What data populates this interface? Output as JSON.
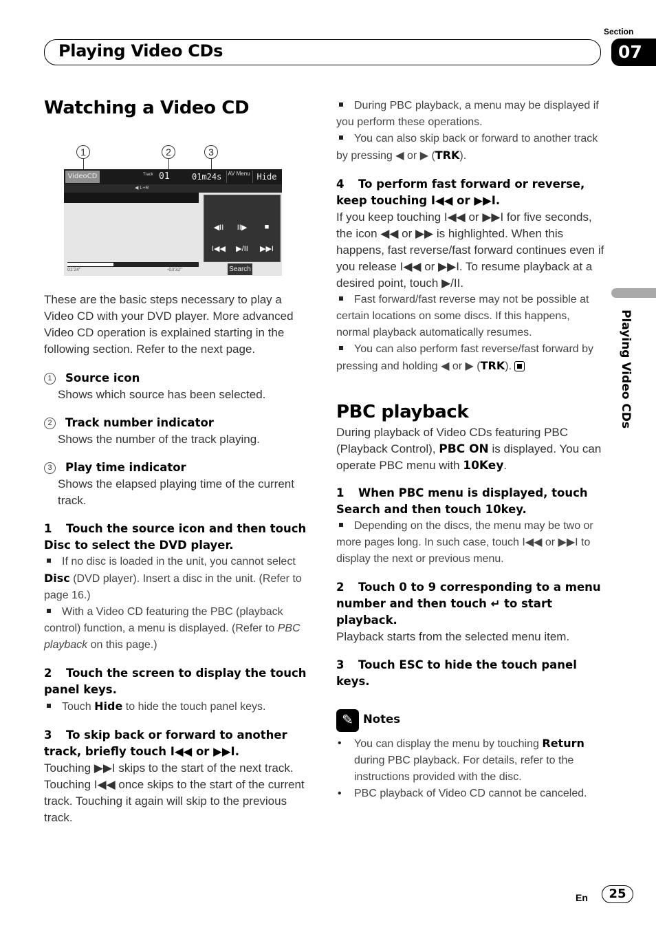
{
  "header": {
    "title": "Playing Video CDs",
    "section_label": "Section",
    "section_number": "07",
    "side_tab_text": "Playing Video CDs"
  },
  "left": {
    "heading": "Watching a Video CD",
    "screen": {
      "source_label": "VideoCD",
      "track_label": "Track",
      "track_value": "01",
      "time_value": "01m24s",
      "av_menu_label": "AV Menu",
      "hide_label": "Hide",
      "audio_label": "L+R",
      "search_label": "Search",
      "progress_fraction": 0.35,
      "elapsed_readout": "01'24\"",
      "remaining_readout": "-03'32\"",
      "buttons_row1": [
        "◀II",
        "II▶",
        "■"
      ],
      "buttons_row2": [
        "I◀◀",
        "▶/II",
        "▶▶I"
      ],
      "callouts": [
        "1",
        "2",
        "3"
      ]
    },
    "intro": "These are the basic steps necessary to play a Video CD with your DVD player. More advanced Video CD operation is explained starting in the following section. Refer to the next page.",
    "items": [
      {
        "num": "1",
        "title": "Source icon",
        "desc": "Shows which source has been selected."
      },
      {
        "num": "2",
        "title": "Track number indicator",
        "desc": "Shows the number of the track playing."
      },
      {
        "num": "3",
        "title": "Play time indicator",
        "desc": "Shows the elapsed playing time of the current track."
      }
    ],
    "step1": {
      "num": "1",
      "title": "Touch the source icon and then touch Disc to select the DVD player.",
      "note1_pre": "If no disc is loaded in the unit, you cannot select ",
      "note1_bold": "Disc",
      "note1_post": " (DVD player). Insert a disc in the unit. (Refer to page 16.)",
      "note2_pre": "With a Video CD featuring the PBC (playback control) function, a menu is displayed. (Refer to ",
      "note2_italic": "PBC playback",
      "note2_post": " on this page.)"
    },
    "step2": {
      "num": "2",
      "title": "Touch the screen to display the touch panel keys.",
      "note_pre": "Touch ",
      "note_bold": "Hide",
      "note_post": " to hide the touch panel keys."
    },
    "step3": {
      "num": "3",
      "title": "To skip back or forward to another track, briefly touch I◀◀ or ▶▶I.",
      "body": "Touching ▶▶I skips to the start of the next track. Touching I◀◀ once skips to the start of the current track. Touching it again will skip to the previous track."
    }
  },
  "right": {
    "note_a": "During PBC playback, a menu may be displayed if you perform these operations.",
    "note_b_pre": "You can also skip back or forward to another track by pressing ◀ or ▶ (",
    "note_b_bold": "TRK",
    "note_b_post": ").",
    "step4": {
      "num": "4",
      "title": "To perform fast forward or reverse, keep touching I◀◀ or ▶▶I.",
      "body": "If you keep touching I◀◀ or ▶▶I for five seconds, the icon ◀◀ or ▶▶ is highlighted. When this happens, fast reverse/fast forward continues even if you release I◀◀ or ▶▶I. To resume playback at a desired point, touch ▶/II.",
      "note1": "Fast forward/fast reverse may not be possible at certain locations on some discs. If this happens, normal playback automatically resumes.",
      "note2_pre": "You can also perform fast reverse/fast forward by pressing and holding ◀ or ▶ (",
      "note2_bold": "TRK",
      "note2_post": ")."
    },
    "pbc": {
      "heading": "PBC playback",
      "intro_pre": "During playback of Video CDs featuring PBC (Playback Control), ",
      "intro_bold1": "PBC ON",
      "intro_mid": " is displayed. You can operate PBC menu with ",
      "intro_bold2": "10Key",
      "intro_post": ".",
      "step1_num": "1",
      "step1_title": "When PBC menu is displayed, touch Search and then touch 10key.",
      "step1_note": "Depending on the discs, the menu may be two or more pages long. In such case, touch I◀◀ or ▶▶I to display the next or previous menu.",
      "step2_num": "2",
      "step2_title": "Touch 0 to 9 corresponding to a menu number and then touch ↵ to start playback.",
      "step2_body": "Playback starts from the selected menu item.",
      "step3_num": "3",
      "step3_title": "Touch ESC to hide the touch panel keys."
    },
    "notes": {
      "title": "Notes",
      "item1_pre": "You can display the menu by touching ",
      "item1_bold": "Return",
      "item1_post": " during PBC playback. For details, refer to the instructions provided with the disc.",
      "item2": "PBC playback of Video CD cannot be canceled."
    }
  },
  "footer": {
    "lang": "En",
    "page": "25"
  }
}
